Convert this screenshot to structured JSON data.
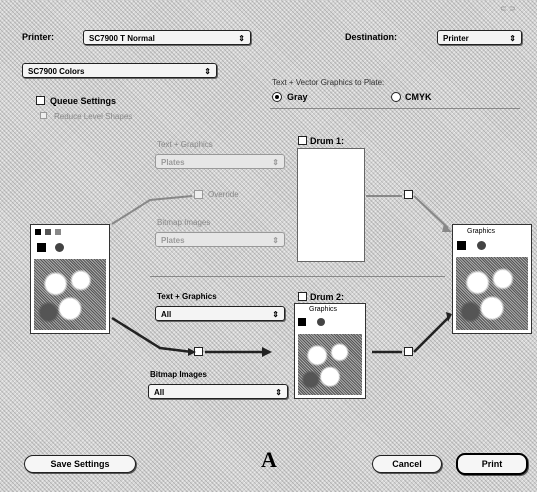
{
  "window": {
    "title_glyph": "⊂ ⊃"
  },
  "header": {
    "printer_label": "Printer:",
    "printer_value": "SC7900 T Normal",
    "destination_label": "Destination:",
    "destination_value": "Printer",
    "colors_popup": "SC7900 Colors",
    "popup_arrow": "⇕"
  },
  "options": {
    "queue_settings": "Queue Settings",
    "queue_sub": "Reduce Level Shapes",
    "gray_section_label": "Text + Vector Graphics to Plate:",
    "gray_label": "Gray",
    "gray_selected": true,
    "cmyk_label": "CMYK",
    "cmyk_selected": false
  },
  "upper": {
    "text_graphics_label": "Text + Graphics",
    "text_graphics_value": "Plates",
    "bitmap_label": "Bitmap Images",
    "bitmap_value": "Plates",
    "override_label": "Override",
    "drum_label": "Drum 1:"
  },
  "lower": {
    "text_graphics_label": "Text + Graphics",
    "text_graphics_value": "All",
    "bitmap_label": "Bitmap Images",
    "bitmap_value": "All",
    "drum_label": "Drum 2:",
    "drum_sub": "Graphics"
  },
  "thumb_left": {
    "swatch_colors": [
      "#000000",
      "#555555",
      "#888888"
    ]
  },
  "thumb_right": {
    "caption": "Graphics"
  },
  "footer": {
    "save_settings": "Save Settings",
    "cancel": "Cancel",
    "print": "Print",
    "logo_glyph": "A"
  },
  "colors": {
    "dialog_bg": "#d4d4d4",
    "white": "#ffffff",
    "border": "#222222"
  }
}
